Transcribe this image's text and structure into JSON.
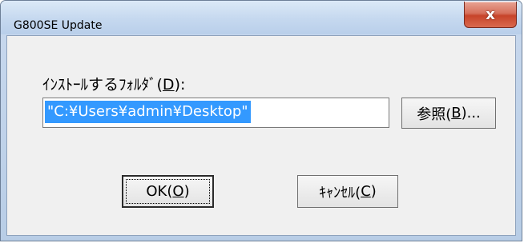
{
  "window": {
    "title": "G800SE Update",
    "close_glyph": "x"
  },
  "form": {
    "folder_label": "ｲﾝｽﾄｰﾙするﾌｫﾙﾀﾞ(D):",
    "folder_label_prefix": "ｲﾝｽﾄｰﾙするﾌｫﾙﾀﾞ(",
    "folder_label_accel": "D",
    "folder_label_suffix": "):",
    "path_value": "\"C:¥Users¥admin¥Desktop\""
  },
  "buttons": {
    "browse_prefix": "参照(",
    "browse_accel": "B",
    "browse_suffix": ")...",
    "ok_prefix": "OK(",
    "ok_accel": "O",
    "ok_suffix": ")",
    "cancel_prefix": "ｷｬﾝｾﾙ(",
    "cancel_accel": "C",
    "cancel_suffix": ")"
  },
  "colors": {
    "selection": "#3399ff",
    "close_button": "#c7442a"
  }
}
